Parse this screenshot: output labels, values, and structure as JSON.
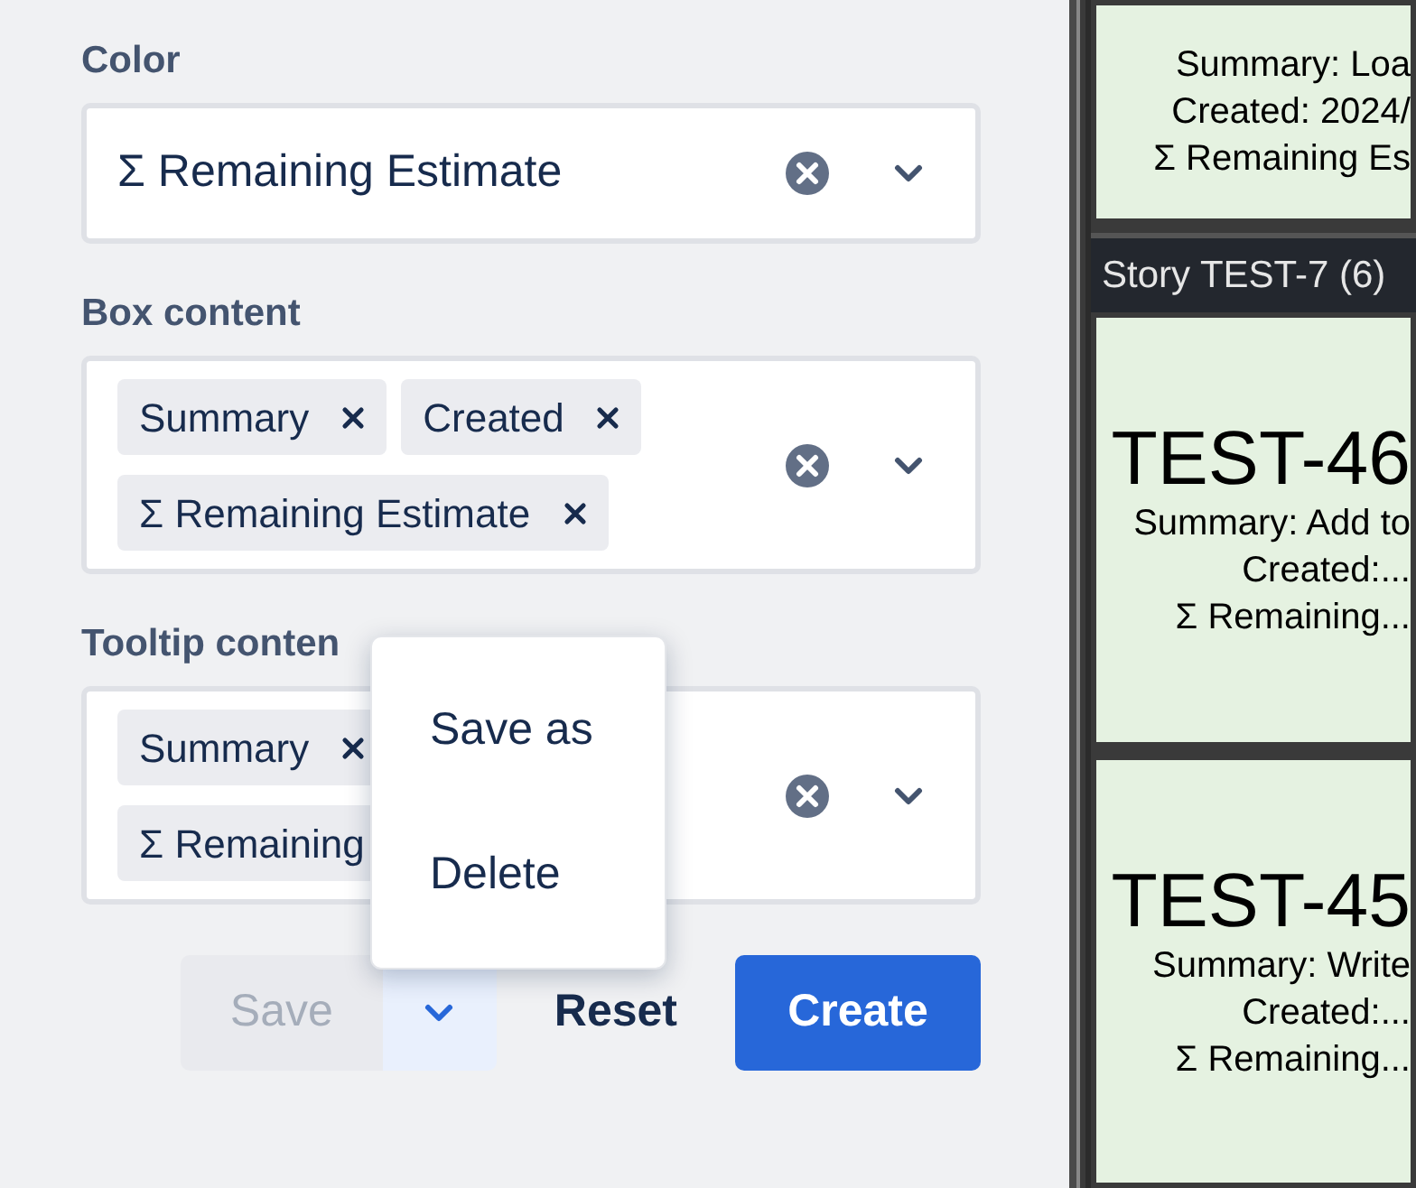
{
  "form": {
    "fields": [
      {
        "label": "Color",
        "kind": "single",
        "value": "Σ Remaining Estimate"
      },
      {
        "label": "Box content",
        "kind": "multi",
        "tag_rows": [
          [
            {
              "text": "Summary",
              "removable": true
            },
            {
              "text": "Created",
              "removable": true
            }
          ],
          [
            {
              "text": "Σ Remaining Estimate",
              "removable": true
            }
          ]
        ]
      },
      {
        "label": "Tooltip conten",
        "kind": "multi",
        "tag_rows": [
          [
            {
              "text": "Summary",
              "removable": true
            }
          ],
          [
            {
              "text": "Σ Remaining",
              "removable": false
            }
          ]
        ]
      }
    ],
    "buttons": [
      {
        "label": "Save",
        "kind": "split",
        "disabled": true
      },
      {
        "label": "Reset",
        "kind": "subtle",
        "disabled": false
      },
      {
        "label": "Create",
        "kind": "primary",
        "disabled": false
      }
    ],
    "menu": {
      "items": [
        "Save as",
        "Delete"
      ]
    }
  },
  "board": {
    "cards": [
      {
        "kind": "card",
        "lines": [
          "Summary: Loa",
          "Created: 2024/",
          "Σ Remaining Es"
        ]
      },
      {
        "kind": "header",
        "title": "Story TEST-7 (6)"
      },
      {
        "kind": "card",
        "key": "TEST-46",
        "lines": [
          "Summary: Add to",
          "Created:...",
          "Σ Remaining..."
        ]
      },
      {
        "kind": "card",
        "key": "TEST-45",
        "lines": [
          "Summary: Write",
          "Created:...",
          "Σ Remaining..."
        ]
      }
    ]
  }
}
